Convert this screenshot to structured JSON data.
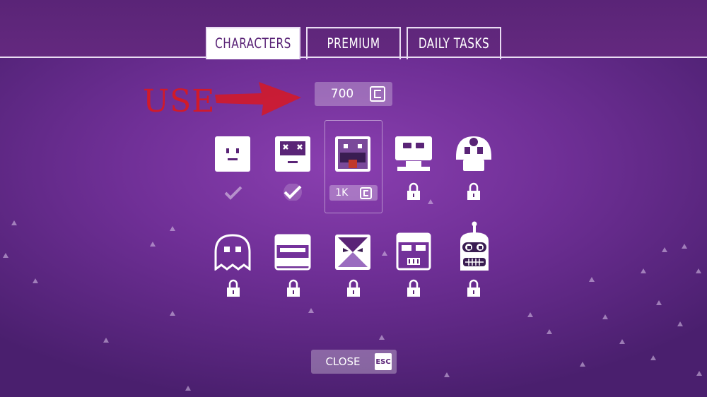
{
  "tabs": [
    {
      "label": "CHARACTERS",
      "active": true
    },
    {
      "label": "PREMIUM",
      "active": false
    },
    {
      "label": "DAILY TASKS",
      "active": false
    }
  ],
  "currency": {
    "amount": "700",
    "icon": "coin-icon"
  },
  "annotation": {
    "text": "USE",
    "color": "#d11a2a"
  },
  "characters_row1": [
    {
      "name": "plain-face",
      "status": "owned"
    },
    {
      "name": "x-eyes-face",
      "status": "selected"
    },
    {
      "name": "tongue-face",
      "status": "for-sale",
      "price": "1K"
    },
    {
      "name": "robot-face",
      "status": "locked"
    },
    {
      "name": "mushroom-face",
      "status": "locked"
    }
  ],
  "characters_row2": [
    {
      "name": "ghost-face",
      "status": "locked"
    },
    {
      "name": "slot-face",
      "status": "locked"
    },
    {
      "name": "angry-face",
      "status": "locked"
    },
    {
      "name": "trooper-face",
      "status": "locked"
    },
    {
      "name": "bender-face",
      "status": "locked"
    }
  ],
  "close": {
    "label": "CLOSE",
    "key": "ESC"
  },
  "colors": {
    "accent": "#5a2477",
    "background": "#6f2f96"
  }
}
